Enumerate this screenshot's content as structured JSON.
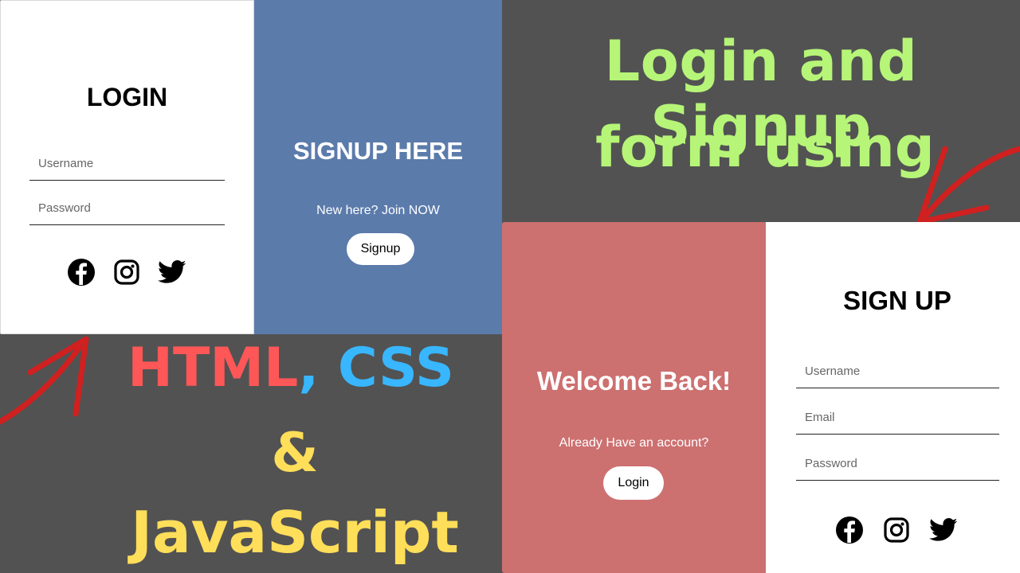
{
  "login": {
    "title": "LOGIN",
    "username_placeholder": "Username",
    "password_placeholder": "Password",
    "social_icons": [
      "facebook-icon",
      "instagram-icon",
      "twitter-icon"
    ]
  },
  "signup_promo": {
    "title": "SIGNUP HERE",
    "text": "New here? Join NOW",
    "button": "Signup",
    "background": "#5b7bab"
  },
  "headline": {
    "line1": "Login and Signup",
    "line2": "form using",
    "html": "HTML",
    "comma": ",",
    "css": "CSS",
    "amp": "&",
    "js": "JavaScript"
  },
  "welcome": {
    "title": "Welcome Back!",
    "text": "Already Have an account?",
    "button": "Login",
    "background": "#cd7070"
  },
  "signup": {
    "title": "SIGN UP",
    "username_placeholder": "Username",
    "email_placeholder": "Email",
    "password_placeholder": "Password",
    "social_icons": [
      "facebook-icon",
      "instagram-icon",
      "twitter-icon"
    ]
  },
  "colors": {
    "background": "#525252",
    "headline_green": "#b6f577",
    "html_red": "#ff5757",
    "css_blue": "#38b6ff",
    "js_yellow": "#ffde59",
    "arrow_red": "#d02020"
  }
}
